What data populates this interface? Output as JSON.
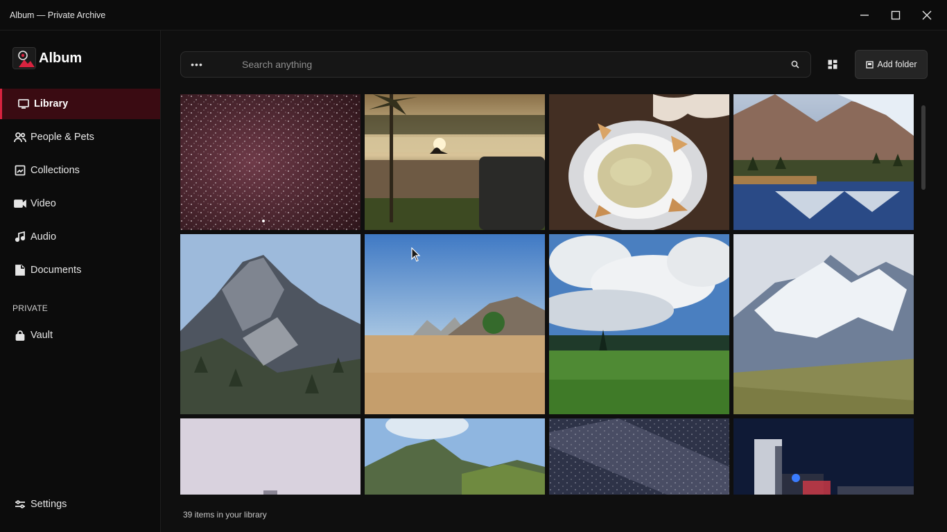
{
  "window": {
    "title": "Album — Private Archive"
  },
  "brand": {
    "name": "Album",
    "logo_icon": "album-logo-icon"
  },
  "sidebar": {
    "items": [
      {
        "label": "Library",
        "icon": "monitor-icon",
        "active": true
      },
      {
        "label": "People & Pets",
        "icon": "people-icon",
        "active": false
      },
      {
        "label": "Collections",
        "icon": "collection-icon",
        "active": false
      },
      {
        "label": "Video",
        "icon": "video-camera-icon",
        "active": false
      },
      {
        "label": "Audio",
        "icon": "music-note-icon",
        "active": false
      },
      {
        "label": "Documents",
        "icon": "document-icon",
        "active": false
      }
    ],
    "private_section_label": "PRIVATE",
    "private_items": [
      {
        "label": "Vault",
        "icon": "lock-icon"
      }
    ],
    "settings_label": "Settings"
  },
  "search": {
    "placeholder": "Search anything",
    "value": ""
  },
  "toolbar": {
    "add_folder_label": "Add folder"
  },
  "gallery": {
    "tiles": [
      "starry-night-sky",
      "sunset-lake-silhouette",
      "plate-of-dip-and-chips",
      "mountain-lake-reflection",
      "rocky-mountain-peak",
      "desert-plain-with-hills",
      "green-meadow-clouds",
      "snowy-mountain-range",
      "pale-sky-horizon",
      "green-mountain-slope",
      "milky-way-sky",
      "city-at-night"
    ]
  },
  "status": {
    "item_count_text": "39 items in your library"
  },
  "colors": {
    "accent": "#d8233f",
    "active_bg": "#3a0b12",
    "background": "#0c0c0c"
  }
}
